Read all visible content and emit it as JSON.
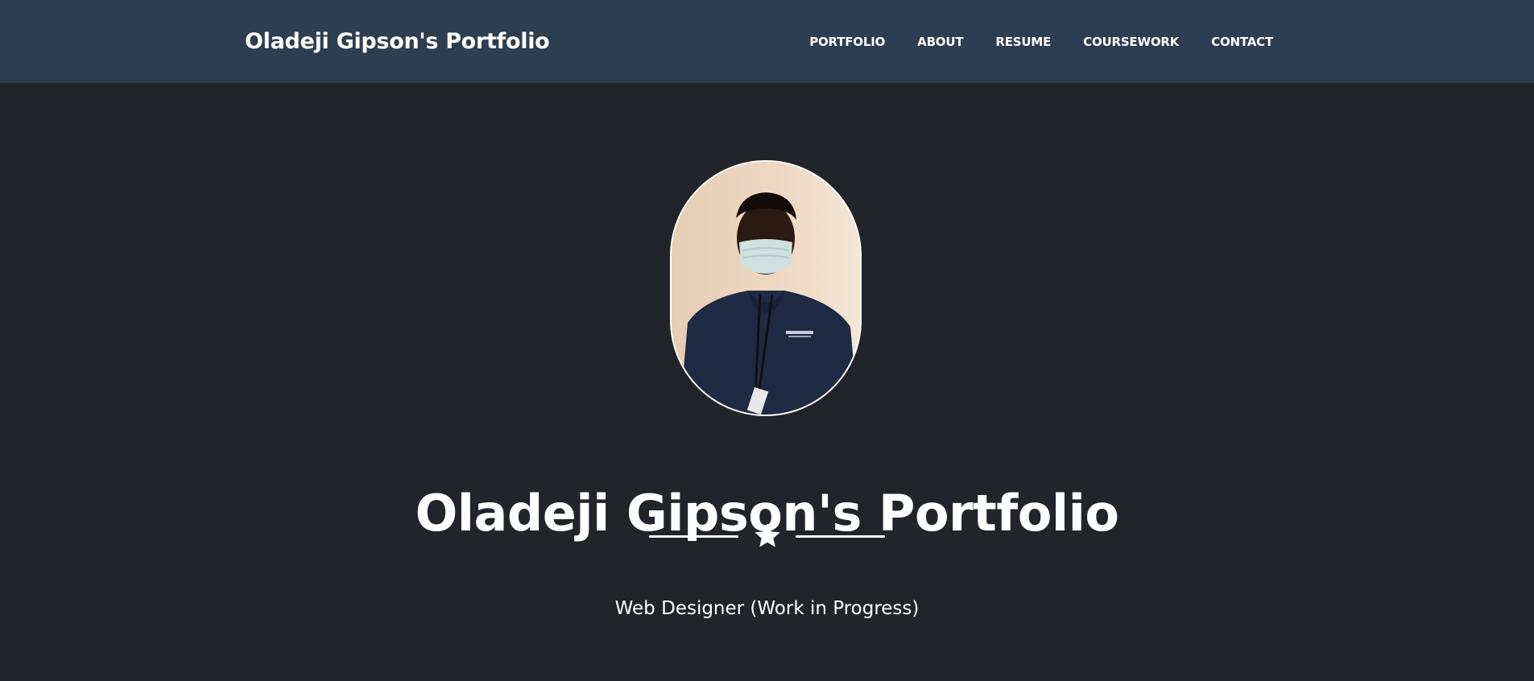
{
  "navbar": {
    "brand": "Oladeji Gipson's Portfolio",
    "links": [
      {
        "label": "Portfolio"
      },
      {
        "label": "About"
      },
      {
        "label": "Resume"
      },
      {
        "label": "Coursework"
      },
      {
        "label": "Contact"
      }
    ]
  },
  "masthead": {
    "heading": "Oladeji Gipson's Portfolio",
    "divider_icon": "star-icon",
    "subheading": "Web Designer (Work in Progress)"
  },
  "colors": {
    "navbar_bg": "#2c3e50",
    "page_bg": "#212529",
    "text": "#ffffff"
  }
}
